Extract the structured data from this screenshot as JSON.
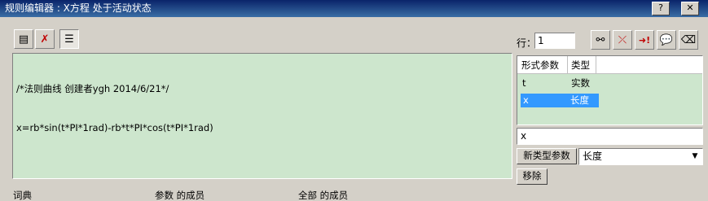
{
  "window": {
    "title": "规则编辑器 : X方程 处于活动状态"
  },
  "titlebar_buttons": {
    "help": "?",
    "close": "✕"
  },
  "toolbar_left": [
    {
      "name": "formula-view-icon",
      "glyph": "▤"
    },
    {
      "name": "check-error-icon",
      "glyph": "✗"
    },
    {
      "name": "text-align-icon",
      "glyph": "☰"
    }
  ],
  "toolbar_right": [
    {
      "name": "binoculars-icon",
      "glyph": "⚯"
    },
    {
      "name": "step-icon",
      "glyph": "⤫"
    },
    {
      "name": "run-icon",
      "glyph": "➜!"
    },
    {
      "name": "speech-bubble-icon",
      "glyph": "💬"
    },
    {
      "name": "eraser-icon",
      "glyph": "⌫"
    }
  ],
  "line": {
    "label": "行：",
    "value": "1"
  },
  "editor": {
    "lines": [
      "/*法则曲线 创建者ygh 2014/6/21*/",
      "x=rb*sin(t*PI*1rad)-rb*t*PI*cos(t*PI*1rad)"
    ]
  },
  "params": {
    "headers": [
      "形式参数",
      "类型"
    ],
    "rows": [
      {
        "name": "t",
        "type": "实数",
        "selected": false
      },
      {
        "name": "x",
        "type": "长度",
        "selected": true
      }
    ]
  },
  "param_input": {
    "value": "x"
  },
  "buttons": {
    "new_type_param": "新类型参数",
    "remove": "移除"
  },
  "type_select": {
    "value": "长度"
  },
  "footer": {
    "dictionary": "词典",
    "param_members": "参数 的成员",
    "all_members": "全部 的成员"
  },
  "colors": {
    "editor_bg": "#cde6cd",
    "selection": "#3399ff",
    "titlebar": "#0a246a"
  }
}
